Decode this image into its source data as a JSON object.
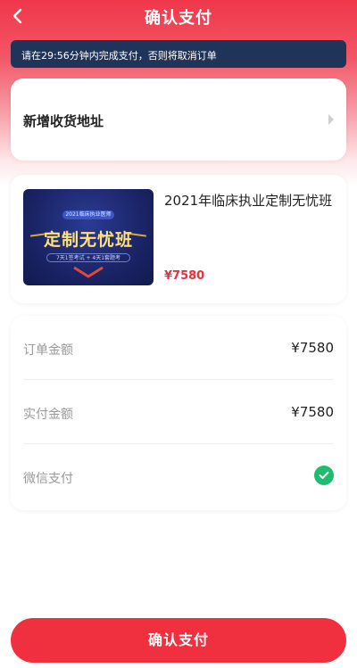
{
  "header": {
    "title": "确认支付"
  },
  "notice": {
    "text": "请在29:56分钟内完成支付，否则将取消订单"
  },
  "address": {
    "label": "新增收货地址"
  },
  "product": {
    "title": "2021年临床执业定制无忧班",
    "price": "¥7580",
    "image": {
      "badge": "2021临床执业医师",
      "main": "定制无忧班",
      "sub": "7天1签考试 + 4天1套题考"
    }
  },
  "summary": {
    "order_amount_label": "订单金额",
    "order_amount_value": "¥7580",
    "paid_amount_label": "实付金额",
    "paid_amount_value": "¥7580",
    "payment_method_label": "微信支付",
    "payment_method_selected": true
  },
  "footer": {
    "confirm_label": "确认支付"
  },
  "colors": {
    "accent": "#f0303e",
    "notice_bg": "#1f3458",
    "check": "#1fbb6e",
    "price": "#e8303f"
  }
}
